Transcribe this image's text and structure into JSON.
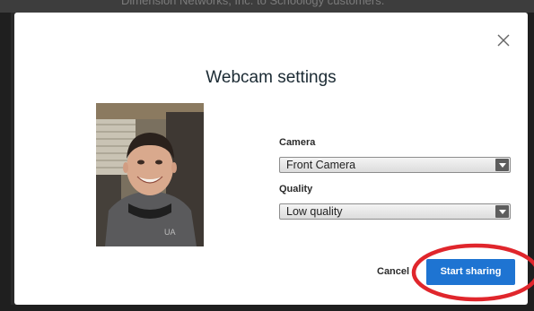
{
  "background": {
    "page_text": "Dimension Networks, Inc. to Schoology customers."
  },
  "dialog": {
    "title": "Webcam settings",
    "close_icon": "close-icon",
    "camera": {
      "label": "Camera",
      "value": "Front Camera"
    },
    "quality": {
      "label": "Quality",
      "value": "Low quality"
    },
    "cancel_label": "Cancel",
    "start_label": "Start sharing"
  },
  "colors": {
    "primary_button": "#1e74d2",
    "highlight_ring": "#e0262c"
  }
}
